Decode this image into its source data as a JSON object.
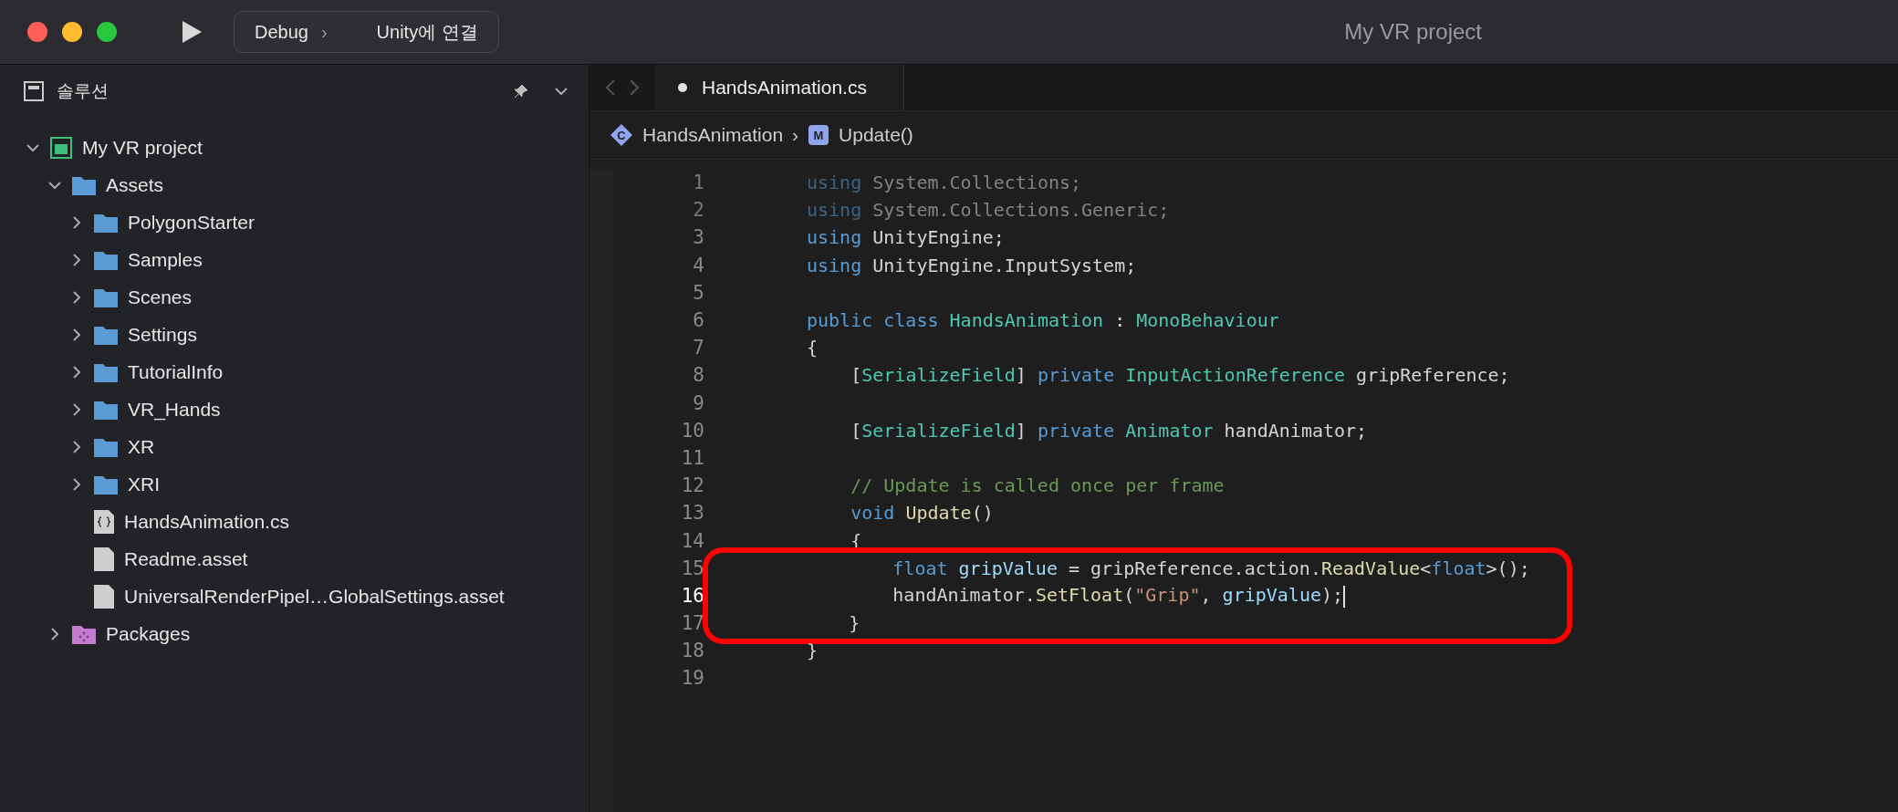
{
  "window": {
    "title": "My VR project"
  },
  "toolbar": {
    "configuration": "Debug",
    "separator": "›",
    "target": "Unity에 연결"
  },
  "sidebar": {
    "title": "솔루션",
    "tree": [
      {
        "label": "My VR project",
        "kind": "project",
        "expanded": true,
        "children": [
          {
            "label": "Assets",
            "kind": "folder",
            "expanded": true,
            "children": [
              {
                "label": "PolygonStarter",
                "kind": "folder",
                "expanded": false
              },
              {
                "label": "Samples",
                "kind": "folder",
                "expanded": false
              },
              {
                "label": "Scenes",
                "kind": "folder",
                "expanded": false
              },
              {
                "label": "Settings",
                "kind": "folder",
                "expanded": false
              },
              {
                "label": "TutorialInfo",
                "kind": "folder",
                "expanded": false
              },
              {
                "label": "VR_Hands",
                "kind": "folder",
                "expanded": false
              },
              {
                "label": "XR",
                "kind": "folder",
                "expanded": false
              },
              {
                "label": "XRI",
                "kind": "folder",
                "expanded": false
              },
              {
                "label": "HandsAnimation.cs",
                "kind": "code"
              },
              {
                "label": "Readme.asset",
                "kind": "file"
              },
              {
                "label": "UniversalRenderPipel…GlobalSettings.asset",
                "kind": "file"
              }
            ]
          },
          {
            "label": "Packages",
            "kind": "package",
            "expanded": false
          }
        ]
      }
    ]
  },
  "tabs": [
    {
      "label": "HandsAnimation.cs",
      "selected": true,
      "modified": true
    }
  ],
  "breadcrumb": [
    {
      "label": "HandsAnimation",
      "kind": "class",
      "badge": "C"
    },
    {
      "label": "Update()",
      "kind": "method",
      "badge": "M"
    }
  ],
  "breadcrumb_separator": "›",
  "code": [
    {
      "number": "1",
      "dimmed": true,
      "current": false,
      "highlighted": false,
      "tokens": [
        {
          "kind": "keyword",
          "text": "using"
        },
        {
          "kind": "plain",
          "text": " System.Collections;"
        }
      ]
    },
    {
      "number": "2",
      "dimmed": true,
      "current": false,
      "highlighted": false,
      "tokens": [
        {
          "kind": "keyword",
          "text": "using"
        },
        {
          "kind": "plain",
          "text": " System.Collections.Generic;"
        }
      ]
    },
    {
      "number": "3",
      "dimmed": false,
      "current": false,
      "highlighted": false,
      "tokens": [
        {
          "kind": "keyword",
          "text": "using"
        },
        {
          "kind": "plain",
          "text": " UnityEngine;"
        }
      ]
    },
    {
      "number": "4",
      "dimmed": false,
      "current": false,
      "highlighted": false,
      "tokens": [
        {
          "kind": "keyword",
          "text": "using"
        },
        {
          "kind": "plain",
          "text": " UnityEngine.InputSystem;"
        }
      ]
    },
    {
      "number": "5",
      "dimmed": false,
      "current": false,
      "highlighted": false
    },
    {
      "number": "6",
      "dimmed": false,
      "current": false,
      "highlighted": false,
      "tokens": [
        {
          "kind": "keyword",
          "text": "public class "
        },
        {
          "kind": "type",
          "text": "HandsAnimation"
        },
        {
          "kind": "plain",
          "text": " : "
        },
        {
          "kind": "type",
          "text": "MonoBehaviour"
        }
      ]
    },
    {
      "number": "7",
      "dimmed": false,
      "current": false,
      "highlighted": false,
      "tokens": [
        {
          "kind": "plain",
          "text": "{"
        }
      ]
    },
    {
      "number": "8",
      "dimmed": false,
      "current": false,
      "highlighted": false,
      "tokens": [
        {
          "kind": "plain",
          "text": "    ["
        },
        {
          "kind": "type",
          "text": "SerializeField"
        },
        {
          "kind": "plain",
          "text": "] "
        },
        {
          "kind": "keyword",
          "text": "private "
        },
        {
          "kind": "type",
          "text": "InputActionReference"
        },
        {
          "kind": "plain",
          "text": " gripReference;"
        }
      ]
    },
    {
      "number": "9",
      "dimmed": false,
      "current": false,
      "highlighted": false
    },
    {
      "number": "10",
      "dimmed": false,
      "current": false,
      "highlighted": false,
      "tokens": [
        {
          "kind": "plain",
          "text": "    ["
        },
        {
          "kind": "type",
          "text": "SerializeField"
        },
        {
          "kind": "plain",
          "text": "] "
        },
        {
          "kind": "keyword",
          "text": "private "
        },
        {
          "kind": "type",
          "text": "Animator"
        },
        {
          "kind": "plain",
          "text": " handAnimator;"
        }
      ]
    },
    {
      "number": "11",
      "dimmed": false,
      "current": false,
      "highlighted": false
    },
    {
      "number": "12",
      "dimmed": false,
      "current": false,
      "highlighted": false,
      "tokens": [
        {
          "kind": "comment",
          "text": "    // Update is called once per frame"
        }
      ]
    },
    {
      "number": "13",
      "dimmed": false,
      "current": false,
      "highlighted": false,
      "tokens": [
        {
          "kind": "keyword",
          "text": "    void "
        },
        {
          "kind": "method",
          "text": "Update"
        },
        {
          "kind": "plain",
          "text": "()"
        }
      ]
    },
    {
      "number": "14",
      "dimmed": false,
      "current": false,
      "highlighted": false,
      "tokens": [
        {
          "kind": "plain",
          "text": "    {"
        }
      ]
    },
    {
      "number": "15",
      "dimmed": false,
      "current": false,
      "highlighted": true,
      "tokens": [
        {
          "kind": "keyword",
          "text": "        float "
        },
        {
          "kind": "variable",
          "text": "gripValue"
        },
        {
          "kind": "plain",
          "text": " = gripReference.action."
        },
        {
          "kind": "method",
          "text": "ReadValue"
        },
        {
          "kind": "plain",
          "text": "<"
        },
        {
          "kind": "keyword",
          "text": "float"
        },
        {
          "kind": "plain",
          "text": ">();"
        }
      ]
    },
    {
      "number": "16",
      "dimmed": false,
      "current": true,
      "highlighted": true,
      "tokens": [
        {
          "kind": "plain",
          "text": "        handAnimator."
        },
        {
          "kind": "method",
          "text": "SetFloat"
        },
        {
          "kind": "plain",
          "text": "("
        },
        {
          "kind": "string",
          "text": "\"Grip\""
        },
        {
          "kind": "plain",
          "text": ", "
        },
        {
          "kind": "variable",
          "text": "gripValue"
        },
        {
          "kind": "plain",
          "text": ");"
        }
      ]
    },
    {
      "number": "17",
      "dimmed": false,
      "current": false,
      "highlighted": true,
      "tokens": [
        {
          "kind": "plain",
          "text": "    }"
        }
      ]
    },
    {
      "number": "18",
      "dimmed": false,
      "current": false,
      "highlighted": false,
      "tokens": [
        {
          "kind": "plain",
          "text": "}"
        }
      ]
    },
    {
      "number": "19",
      "dimmed": false,
      "current": false,
      "highlighted": false
    }
  ]
}
